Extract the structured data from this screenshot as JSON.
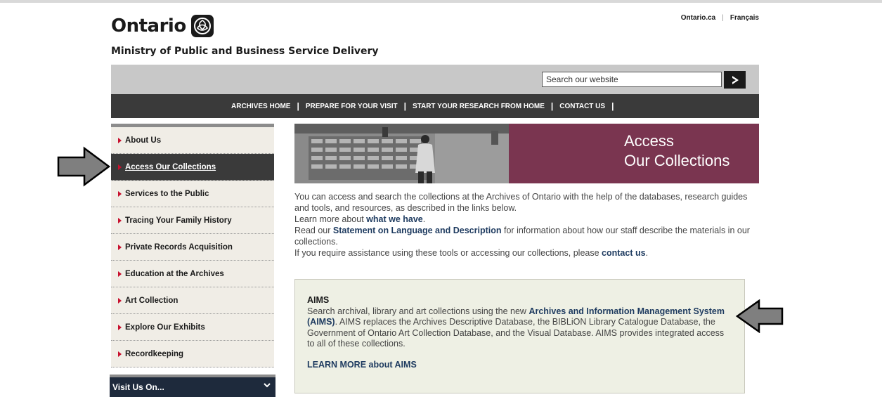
{
  "header": {
    "brand": "Ontario",
    "ministry": "Ministry of Public and Business Service Delivery",
    "top_links": [
      "Ontario.ca",
      "Français"
    ]
  },
  "search": {
    "value": "Search our website",
    "placeholder": "Search our website"
  },
  "main_nav": [
    "ARCHIVES HOME",
    "PREPARE FOR YOUR VISIT",
    "START YOUR RESEARCH FROM HOME",
    "CONTACT US"
  ],
  "sidebar": {
    "items": [
      {
        "label": "About Us"
      },
      {
        "label": "Access Our Collections"
      },
      {
        "label": "Services to the Public"
      },
      {
        "label": "Tracing Your Family History"
      },
      {
        "label": "Private Records Acquisition"
      },
      {
        "label": "Education at the Archives"
      },
      {
        "label": "Art Collection"
      },
      {
        "label": "Explore Our Exhibits"
      },
      {
        "label": "Recordkeeping"
      }
    ],
    "visit_label": "Visit Us On..."
  },
  "hero": {
    "line1": "Access",
    "line2": "Our Collections"
  },
  "intro": {
    "p1": "You can access and search the collections at the Archives of Ontario with the help of the databases, research guides and tools, and resources, as described in the links below.",
    "p2_pre": "Learn more about ",
    "p2_link": "what we have",
    "p2_post": ".",
    "p3_pre": "Read our ",
    "p3_link": "Statement on Language and Description",
    "p3_post": " for information about how our staff describe the materials in our collections.",
    "p4_pre": "If you require assistance using these tools or accessing our collections, please ",
    "p4_link": "contact us",
    "p4_post": "."
  },
  "aims": {
    "title": "AIMS",
    "text_pre": "Search archival, library and art collections using the new ",
    "text_link": "Archives and Information Management System (AIMS)",
    "text_post": ".  AIMS replaces the Archives Descriptive Database, the BIBLiON Library Catalogue Database, the Government of Ontario Art Collection Database, and the Visual Database. AIMS provides integrated access to all of these collections.",
    "learn_more": "LEARN MORE about AIMS"
  },
  "colors": {
    "hero_title_bg": "#7a3550",
    "nav_bg": "#3a3a3a",
    "sidebar_bg": "#f0ede6",
    "aims_bg": "#eef0e4",
    "link": "#1d3a5f",
    "bullet": "#c8102e",
    "visit_bg": "#1e2a3c"
  },
  "icons": [
    "trillium-logo-icon",
    "search-arrow-icon",
    "red-triangle-icon",
    "chevron-down-icon",
    "pointer-arrow-icon"
  ]
}
